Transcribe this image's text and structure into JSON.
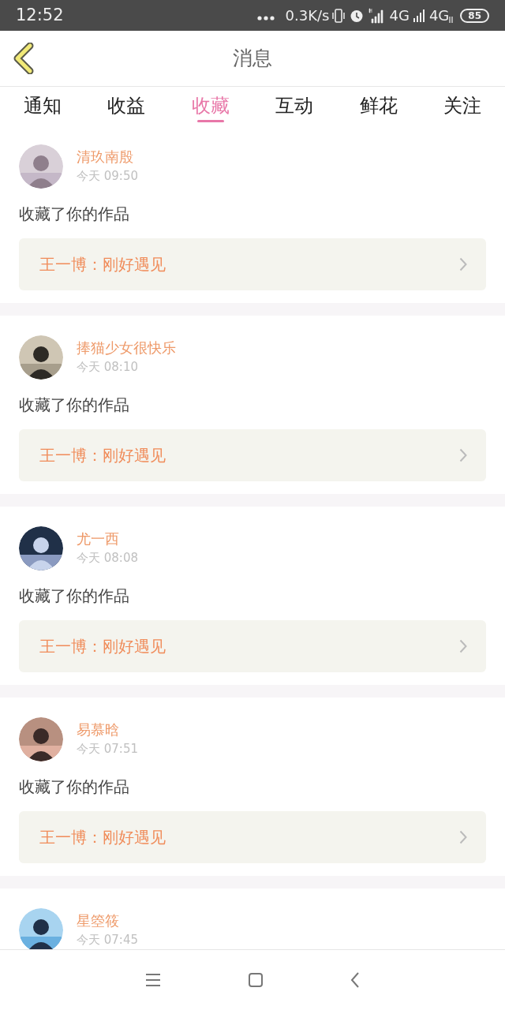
{
  "status_bar": {
    "time": "12:52",
    "speed": "0.3K/s",
    "network_1": "4G",
    "network_2": "4G",
    "battery": "85"
  },
  "header": {
    "title": "消息"
  },
  "tabs": [
    {
      "label": "通知",
      "selected": false
    },
    {
      "label": "收益",
      "selected": false
    },
    {
      "label": "收藏",
      "selected": true
    },
    {
      "label": "互动",
      "selected": false
    },
    {
      "label": "鲜花",
      "selected": false
    },
    {
      "label": "关注",
      "selected": false
    }
  ],
  "messages": [
    {
      "name": "清玖南殷",
      "time": "今天 09:50",
      "action": "收藏了你的作品",
      "work": "王一博：刚好遇见"
    },
    {
      "name": "捧猫少女很快乐",
      "time": "今天 08:10",
      "action": "收藏了你的作品",
      "work": "王一博：刚好遇见"
    },
    {
      "name": "尤一西",
      "time": "今天 08:08",
      "action": "收藏了你的作品",
      "work": "王一博：刚好遇见"
    },
    {
      "name": "易慕晗",
      "time": "今天 07:51",
      "action": "收藏了你的作品",
      "work": "王一博：刚好遇见"
    },
    {
      "name": "星箜筱",
      "time": "今天 07:45"
    }
  ]
}
